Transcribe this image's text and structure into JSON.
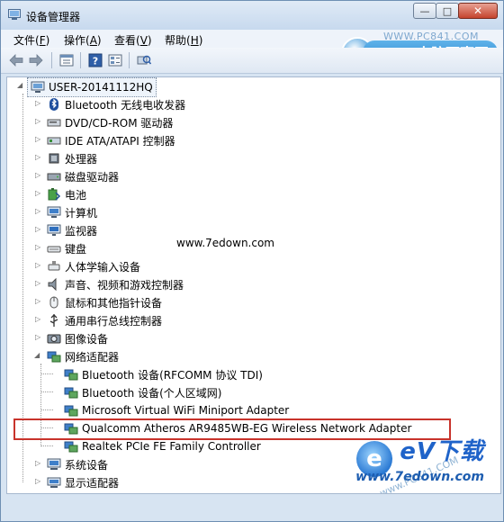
{
  "window": {
    "title": "设备管理器",
    "buttons": {
      "minimize": "—",
      "maximize": "□",
      "close": "✕"
    }
  },
  "menu": [
    {
      "label": "文件(",
      "key": "F",
      "tail": ")"
    },
    {
      "label": "操作(",
      "key": "A",
      "tail": ")"
    },
    {
      "label": "查看(",
      "key": "V",
      "tail": ")"
    },
    {
      "label": "帮助(",
      "key": "H",
      "tail": ")"
    }
  ],
  "toolbar": {
    "icons": [
      "back-arrow-icon",
      "forward-arrow-icon",
      "properties-icon",
      "help-icon",
      "device-view-icon",
      "scan-hardware-icon"
    ]
  },
  "watermark": {
    "site": "WWW.PC841.COM",
    "brand": "电脑百事网",
    "mid": "www.7edown.com",
    "diag": "www.PC841.COM",
    "corner_big": "eV下载",
    "corner_url": "www.7edown.com"
  },
  "tree": {
    "root": "USER-20141112HQ",
    "items": [
      {
        "label": "Bluetooth 无线电收发器",
        "icon": "bluetooth-icon"
      },
      {
        "label": "DVD/CD-ROM 驱动器",
        "icon": "dvd-drive-icon"
      },
      {
        "label": "IDE ATA/ATAPI 控制器",
        "icon": "ide-controller-icon"
      },
      {
        "label": "处理器",
        "icon": "processor-icon"
      },
      {
        "label": "磁盘驱动器",
        "icon": "disk-drive-icon"
      },
      {
        "label": "电池",
        "icon": "battery-icon"
      },
      {
        "label": "计算机",
        "icon": "computer-icon"
      },
      {
        "label": "监视器",
        "icon": "monitor-icon"
      },
      {
        "label": "键盘",
        "icon": "keyboard-icon"
      },
      {
        "label": "人体学输入设备",
        "icon": "hid-icon"
      },
      {
        "label": "声音、视频和游戏控制器",
        "icon": "sound-icon"
      },
      {
        "label": "鼠标和其他指针设备",
        "icon": "mouse-icon"
      },
      {
        "label": "通用串行总线控制器",
        "icon": "usb-icon"
      },
      {
        "label": "图像设备",
        "icon": "imaging-icon"
      },
      {
        "label": "网络适配器",
        "icon": "network-adapter-icon",
        "expanded": true
      },
      {
        "label": "系统设备",
        "icon": "system-device-icon"
      },
      {
        "label": "显示适配器",
        "icon": "display-adapter-icon"
      }
    ],
    "network_children": [
      "Bluetooth 设备(RFCOMM 协议 TDI)",
      "Bluetooth 设备(个人区域网)",
      "Microsoft Virtual WiFi Miniport Adapter",
      "Qualcomm Atheros AR9485WB-EG Wireless Network Adapter",
      "Realtek PCIe FE Family Controller"
    ],
    "highlighted_child": "Qualcomm Atheros AR9485WB-EG Wireless Network Adapter"
  },
  "colors": {
    "highlight_border": "#c8332b",
    "title_bar": "#c7d9ee"
  }
}
